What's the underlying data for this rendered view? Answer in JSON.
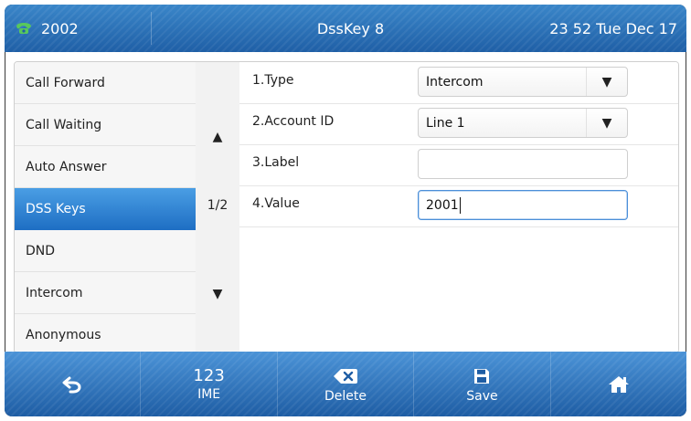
{
  "status_bar": {
    "extension": "2002",
    "title": "DssKey 8",
    "datetime": "23 52 Tue Dec 17"
  },
  "left_menu": {
    "items": [
      {
        "label": "Call Forward"
      },
      {
        "label": "Call Waiting"
      },
      {
        "label": "Auto Answer"
      },
      {
        "label": "DSS Keys",
        "active": true
      },
      {
        "label": "DND"
      },
      {
        "label": "Intercom"
      },
      {
        "label": "Anonymous"
      }
    ]
  },
  "pager": {
    "up_arrow": "▲",
    "page": "1/2",
    "down_arrow": "▼"
  },
  "form": {
    "type_label": "1.Type",
    "type_value": "Intercom",
    "account_label": "2.Account ID",
    "account_value": "Line 1",
    "label_label": "3.Label",
    "label_value": "",
    "value_label": "4.Value",
    "value_value": "2001",
    "select_arrow": "▼"
  },
  "softkeys": {
    "ime_number": "123",
    "ime_label": "IME",
    "delete_label": "Delete",
    "save_label": "Save"
  },
  "icons": {
    "phone": "phone-icon",
    "back": "back-arrow-icon",
    "delete": "backspace-icon",
    "save": "floppy-disk-icon",
    "home": "home-icon"
  },
  "colors": {
    "accent_blue": "#1f6fc4",
    "status_green": "#58c85b"
  }
}
